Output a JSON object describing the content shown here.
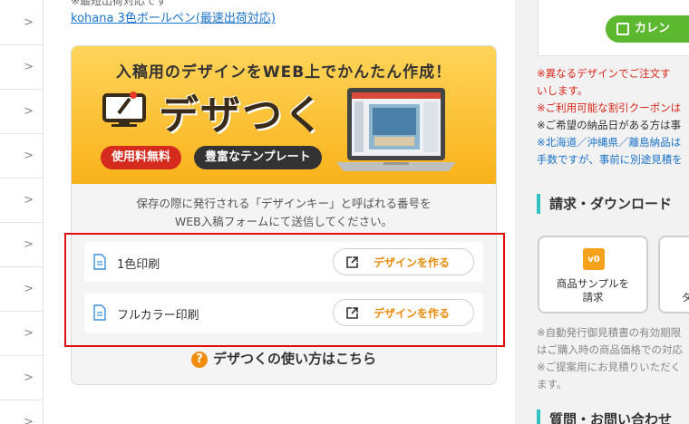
{
  "product": {
    "note": "※最短出荷対応です",
    "link": "kohana 3色ボールペン(最速出荷対応)"
  },
  "banner": {
    "tagline": "入稿用のデザインをWEB上でかんたん作成！",
    "logo": "デザつく",
    "badge_free": "使用料無料",
    "badge_template": "豊富なテンプレート"
  },
  "description": {
    "line1": "保存の際に発行される「デザインキー」と呼ばれる番号を",
    "line2": "WEB入稿フォームにて送信してください。"
  },
  "options": [
    {
      "label": "1色印刷",
      "button": "デザインを作る"
    },
    {
      "label": "フルカラー印刷",
      "button": "デザインを作る"
    }
  ],
  "howto": "デザつくの使い方はこちら",
  "sidebar": {
    "calendar_button": "カレン",
    "notes": [
      {
        "text": "※異なるデザインでご注文す",
        "color": "red"
      },
      {
        "text": "いします。",
        "color": "red"
      },
      {
        "text": "※ご利用可能な割引クーポンは",
        "color": "red"
      },
      {
        "text": "※ご希望の納品日がある方は事",
        "color": "dark"
      },
      {
        "text": "※北海道／沖縄県／離島納品は",
        "color": "blue"
      },
      {
        "text": "手数ですが、事前に別途見積を",
        "color": "blue"
      }
    ],
    "section_title": "請求・ダウンロード",
    "sample_card": {
      "icon_text": "v0",
      "line1": "商品サンプルを",
      "line2": "請求"
    },
    "sample_card2_label": "ダ",
    "notes2": [
      "※自動発行御見積書の有効期限",
      "はご購入時の商品価格での対応",
      "※ご提案用にお見積りいただく",
      "ます。"
    ],
    "faq_title": "質問・お問い合わせ"
  },
  "colors": {
    "accent_orange": "#f08d0d",
    "link_blue": "#1a73c8",
    "highlight_red": "#e01010",
    "calendar_green": "#5cb82e"
  }
}
